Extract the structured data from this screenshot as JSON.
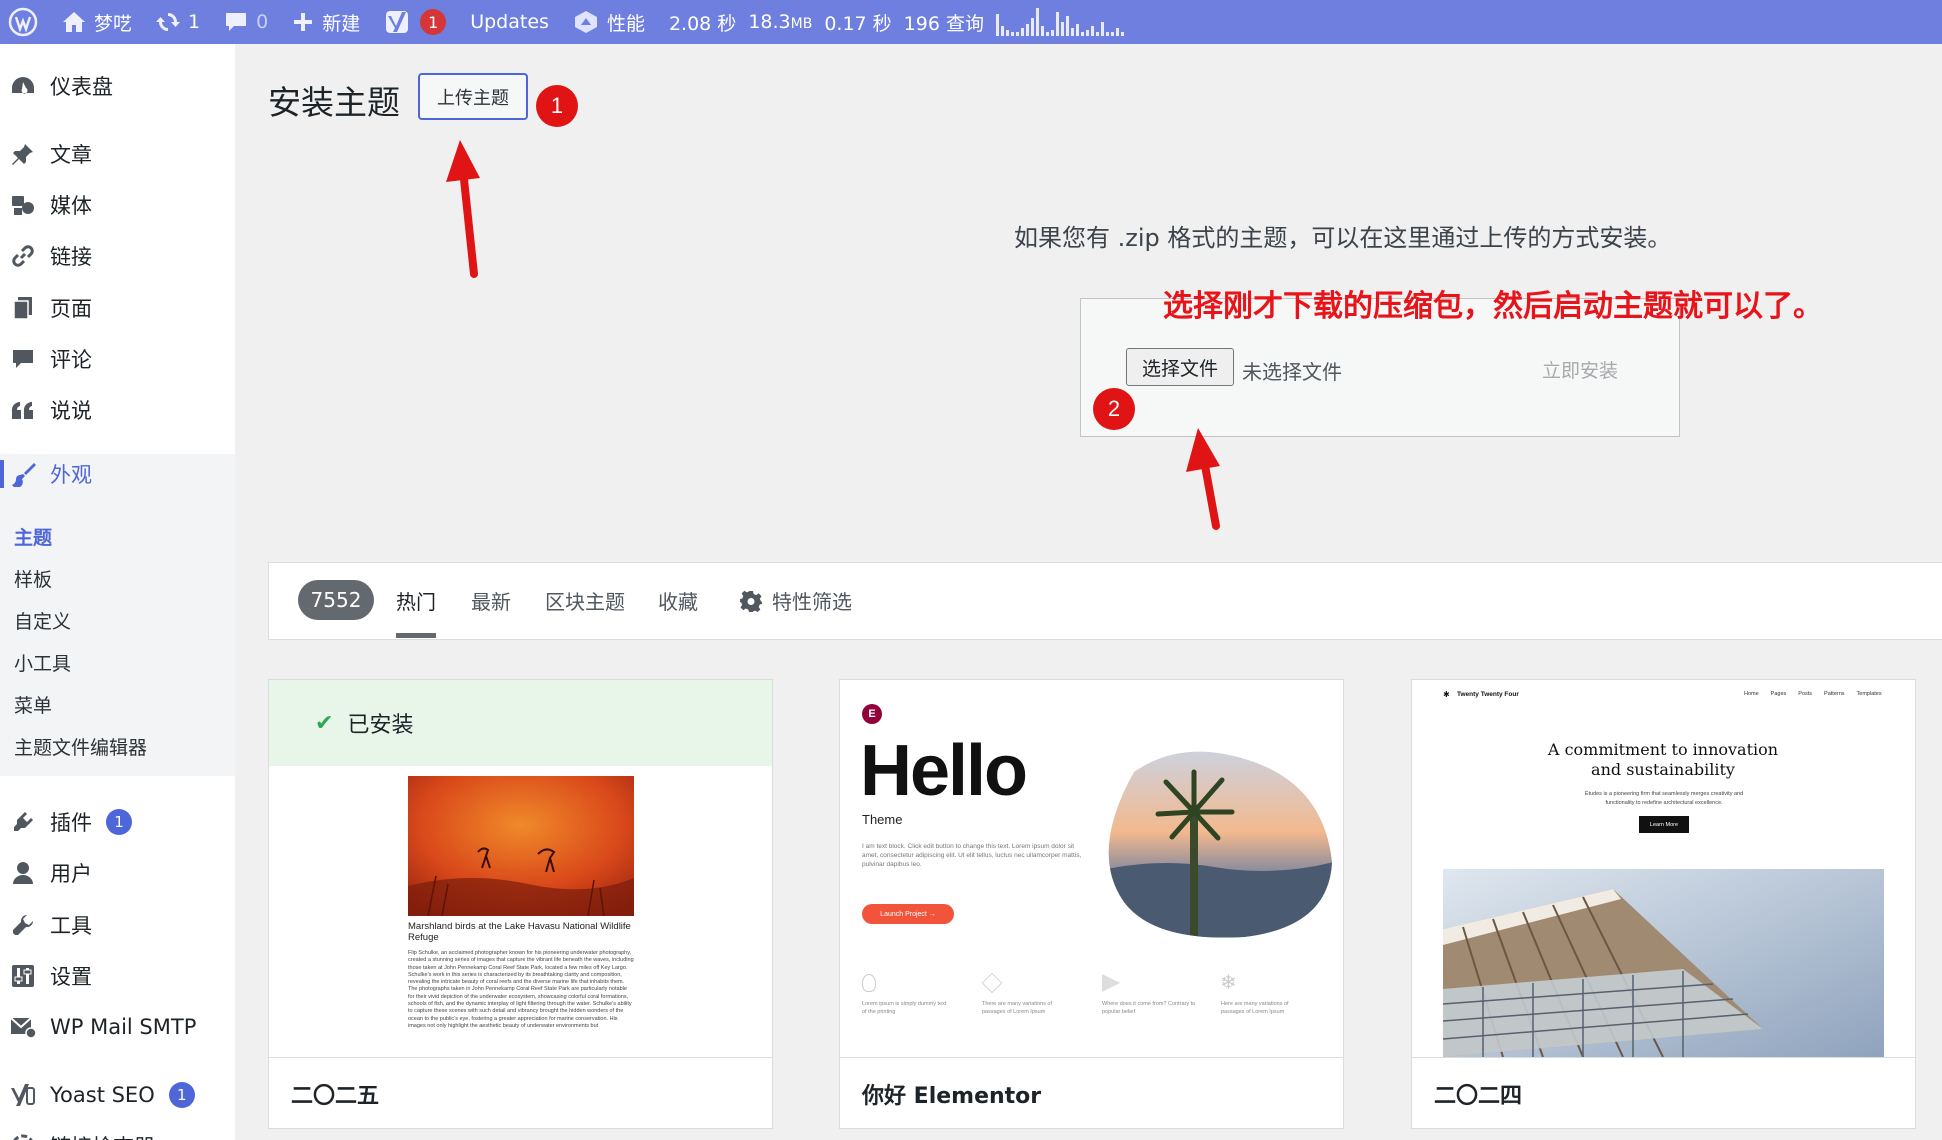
{
  "adminbar": {
    "site_name": "梦呓",
    "updates_count": "1",
    "comments_count": "0",
    "new_label": "新建",
    "yoast_badge": "1",
    "updates_label": "Updates",
    "perf_label": "性能",
    "perf_time": "2.08 秒",
    "perf_mem": "18.3",
    "perf_mem_unit": "MB",
    "perf_query_time": "0.17 秒",
    "perf_queries": "196 查询"
  },
  "sidebar": {
    "dashboard": "仪表盘",
    "posts": "文章",
    "media": "媒体",
    "links": "链接",
    "pages": "页面",
    "comments": "评论",
    "shuoshuo": "说说",
    "appearance": "外观",
    "submenu": {
      "themes": "主题",
      "patterns": "样板",
      "customize": "自定义",
      "widgets": "小工具",
      "menus": "菜单",
      "theme_editor": "主题文件编辑器"
    },
    "plugins": "插件",
    "plugins_badge": "1",
    "users": "用户",
    "tools": "工具",
    "settings": "设置",
    "wp_mail_smtp": "WP Mail SMTP",
    "yoast": "Yoast SEO",
    "yoast_badge": "1",
    "link_checker": "链接检查器"
  },
  "main": {
    "title": "安装主题",
    "upload_button": "上传主题",
    "help_text": "如果您有 .zip 格式的主题，可以在这里通过上传的方式安装。",
    "choose_file": "选择文件",
    "no_file": "未选择文件",
    "install_now": "立即安装"
  },
  "annotations": {
    "marker_1": "1",
    "marker_2": "2",
    "note": "选择刚才下载的压缩包，然后启动主题就可以了。"
  },
  "filter": {
    "count": "7552",
    "tabs": [
      "热门",
      "最新",
      "区块主题",
      "收藏"
    ],
    "feature_filter": "特性筛选"
  },
  "themes": [
    {
      "name": "二〇二五",
      "installed_label": "已安装",
      "preview_caption": "Marshland birds at the Lake Havasu National Wildlife Refuge",
      "preview_body": "Flip Schulke, an acclaimed photographer known for his pioneering underwater photography, created a stunning series of images that capture the vibrant life beneath the waves, including those taken at John Pennekamp Coral Reef State Park, located a few miles off Key Largo. Schulke's work in this series is characterized by its breathtaking clarity and composition, revealing the intricate beauty of coral reefs and the diverse marine life that inhabits them. The photographs taken in John Pennekamp Coral Reef State Park are particularly notable for their vivid depiction of the underwater ecosystem, showcasing colorful coral formations, schools of fish, and the dynamic interplay of light filtering through the water. Schulke's ability to capture these scenes with such detail and vibrancy brought the hidden wonders of the ocean to the public's eye, fostering a greater appreciation for marine conservation. His images not only highlight the aesthetic beauty of underwater environments but"
    },
    {
      "name": "你好 Elementor",
      "preview_headline": "Hello",
      "preview_sub": "Theme",
      "preview_body": "I am text block. Click edit button to change this text. Lorem ipsum dolor sit amet, consectetur adipiscing elit. Ut elit tellus, luctus nec ullamcorper mattis, pulvinar dapibus leo.",
      "preview_button": "Launch Project →",
      "preview_features": [
        "Lorem ipsum is simply dummy text of the printing",
        "There are many variations of passages of Lorem Ipsum",
        "Where does it come from? Contrary to popular belief",
        "Here are many variations of passages of Lorem Ipsum"
      ]
    },
    {
      "name": "二〇二四",
      "preview_site": "Twenty Twenty Four",
      "preview_nav": [
        "Home",
        "Pages",
        "Posts",
        "Patterns",
        "Templates"
      ],
      "preview_heading": "A commitment to innovation and sustainability",
      "preview_text": "Études is a pioneering firm that seamlessly merges creativity and functionality to redefine architectural excellence.",
      "preview_button": "Learn More"
    }
  ],
  "colors": {
    "adminbar": "#6e7fe0",
    "accent": "#4f66d8",
    "annotation_red": "#e01414"
  }
}
